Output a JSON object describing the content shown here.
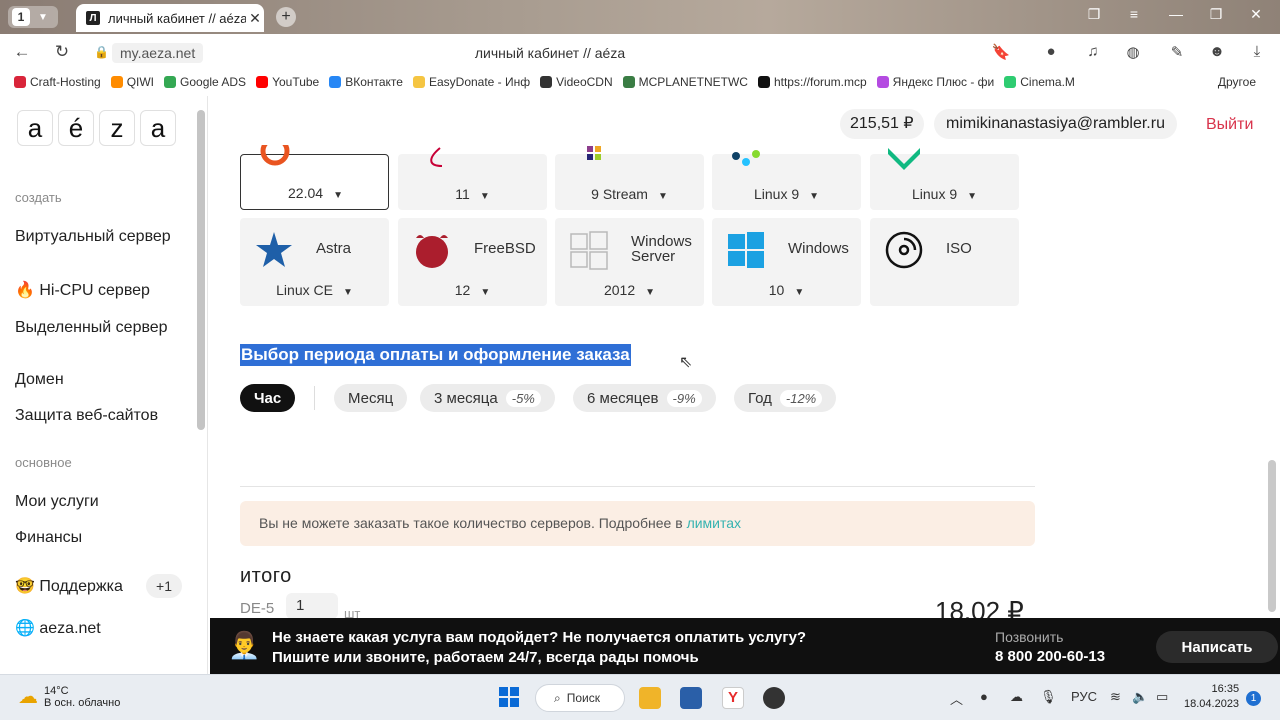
{
  "browser": {
    "tab_count": "1",
    "tab_favicon": "Л",
    "tab_title": "личный кабинет // aéza",
    "url": "my.aeza.net",
    "page_title": "личный кабинет // aéza",
    "bookmarks": [
      {
        "label": "Craft-Hosting",
        "color": "#d9253a"
      },
      {
        "label": "QIWI",
        "color": "#ff8c00"
      },
      {
        "label": "Google ADS",
        "color": "#34a853"
      },
      {
        "label": "YouTube",
        "color": "#ff0000"
      },
      {
        "label": "ВКонтакте",
        "color": "#2787f5"
      },
      {
        "label": "EasyDonate - Инф",
        "color": "#f5c542"
      },
      {
        "label": "VideoCDN",
        "color": "#333333"
      },
      {
        "label": "MCPLANETNETWC",
        "color": "#3a7d44"
      },
      {
        "label": "https://forum.mcp",
        "color": "#111111"
      },
      {
        "label": "Яндекс Плюс - фи",
        "color": "#b44be1"
      },
      {
        "label": "Cinema.M",
        "color": "#2ecc71"
      }
    ],
    "bookmarks_other": "Другое"
  },
  "sidebar": {
    "logo_letters": [
      "a",
      "é",
      "z",
      "a"
    ],
    "section_create": "создать",
    "create_items": [
      "Виртуальный сервер",
      "🔥 Hi-CPU сервер",
      "Выделенный сервер",
      "Домен",
      "Защита веб-сайтов"
    ],
    "section_main": "основное",
    "main_items": [
      "Мои услуги",
      "Финансы"
    ],
    "support": "🤓 Поддержка",
    "support_badge": "+1",
    "site": "🌐 aeza.net"
  },
  "header": {
    "balance": "215,51 ₽",
    "email": "mimikinanastasiya@rambler.ru",
    "logout": "Выйти"
  },
  "os_row1": [
    {
      "version": "22.04",
      "selected": true,
      "color": "#e95420"
    },
    {
      "version": "11",
      "selected": false,
      "color": "#c70036"
    },
    {
      "version": "9 Stream",
      "selected": false,
      "color": "#8c3d8c"
    },
    {
      "version": "Linux 9",
      "selected": false,
      "color": "#0f4266"
    },
    {
      "version": "Linux 9",
      "selected": false,
      "color": "#10b981"
    }
  ],
  "os_row2": [
    {
      "name": "Astra",
      "version": "Linux CE",
      "icon": "star-icon",
      "color": "#1e5fa8"
    },
    {
      "name": "FreeBSD",
      "version": "12",
      "icon": "freebsd-daemon-icon",
      "color": "#ab1e2d"
    },
    {
      "name": "Windows Server",
      "version": "2012",
      "icon": "windows-outline-icon",
      "color": "#b9b9b9"
    },
    {
      "name": "Windows",
      "version": "10",
      "icon": "windows-logo-icon",
      "color": "#1ba1e2"
    },
    {
      "name": "ISO",
      "version": "",
      "icon": "disc-icon",
      "color": "#111111"
    }
  ],
  "billing": {
    "title": "Выбор периода оплаты и оформление заказа",
    "periods": [
      {
        "label": "Час",
        "discount": "",
        "active": true
      },
      {
        "label": "Месяц",
        "discount": "",
        "active": false
      },
      {
        "label": "3 месяца",
        "discount": "-5%",
        "active": false
      },
      {
        "label": "6 месяцев",
        "discount": "-9%",
        "active": false
      },
      {
        "label": "Год",
        "discount": "-12%",
        "active": false
      }
    ]
  },
  "warning": {
    "text": "Вы не можете заказать такое количество серверов. Подробнее в ",
    "link": "лимитах"
  },
  "total": {
    "title": "итого",
    "item": "DE-5",
    "qty": "1",
    "unit": "шт",
    "price": "18,02 ₽"
  },
  "banner": {
    "line1": "Не знаете какая услуга вам подойдет? Не получается оплатить услугу?",
    "line2": "Пишите или звоните, работаем 24/7, всегда рады помочь",
    "call_label": "Позвонить",
    "phone": "8 800 200-60-13",
    "write": "Написать"
  },
  "taskbar": {
    "temp": "14°C",
    "weather": "В осн. облачно",
    "search": "Поиск",
    "lang": "РУС",
    "time": "16:35",
    "date": "18.04.2023",
    "notifications": "1"
  }
}
